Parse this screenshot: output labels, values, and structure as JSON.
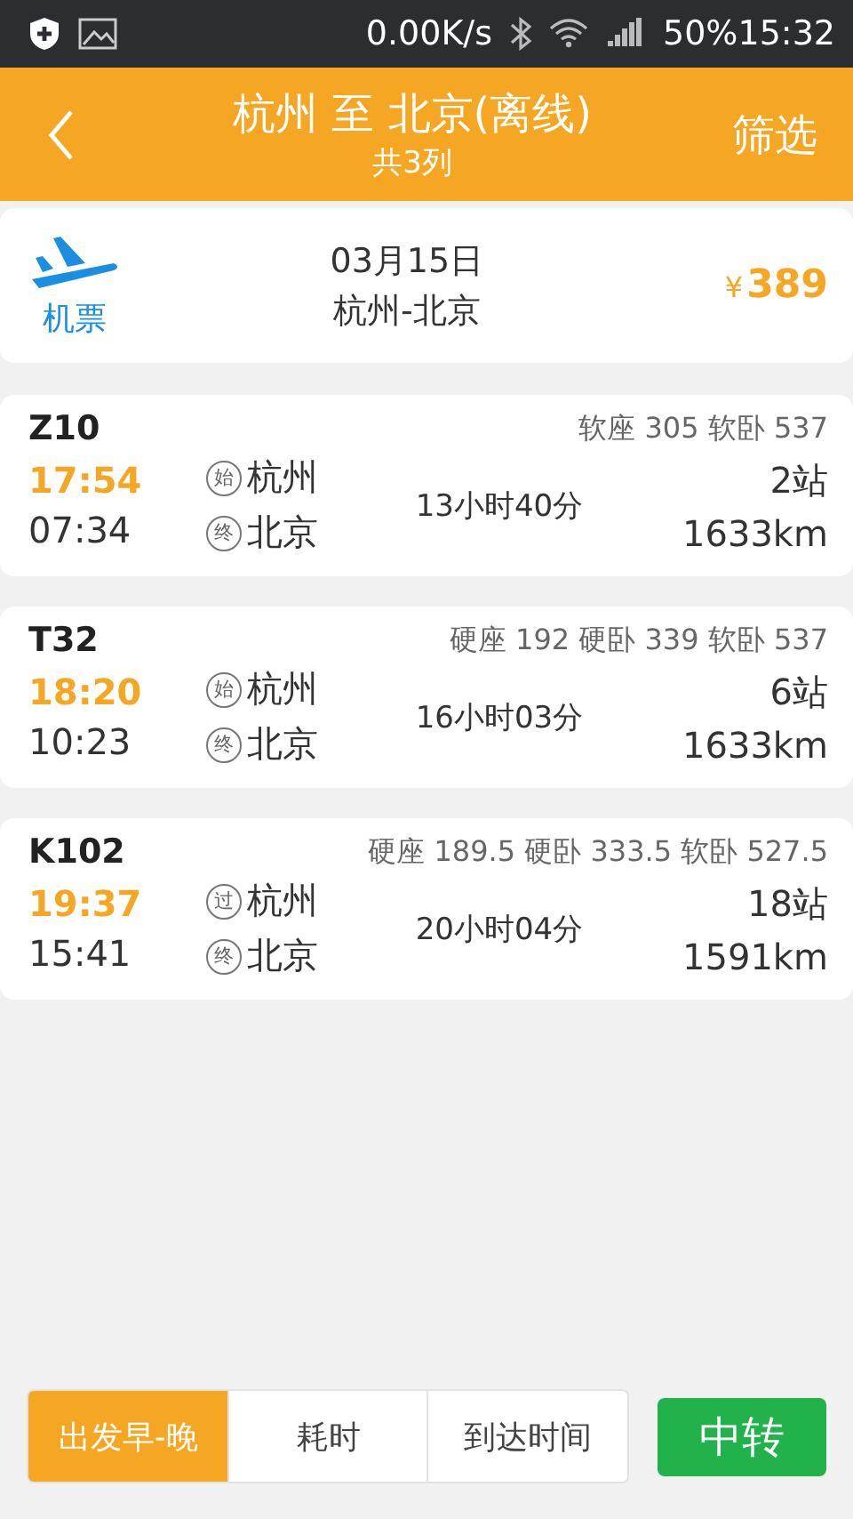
{
  "status_bar": {
    "speed": "0.00K/s",
    "battery": "50%",
    "time": "15:32"
  },
  "header": {
    "title": "杭州 至 北京(离线)",
    "subtitle": "共3列",
    "filter": "筛选"
  },
  "flight": {
    "label": "机票",
    "date": "03月15日",
    "route": "杭州-北京",
    "currency": "¥",
    "price": "389"
  },
  "trains": [
    {
      "number": "Z10",
      "seats": "软座 305 软卧 537",
      "depart_time": "17:54",
      "arrive_time": "07:34",
      "from_mark": "始",
      "from": "杭州",
      "to_mark": "终",
      "to": "北京",
      "duration": "13小时40分",
      "stops": "2站",
      "distance": "1633km"
    },
    {
      "number": "T32",
      "seats": "硬座 192 硬卧 339 软卧 537",
      "depart_time": "18:20",
      "arrive_time": "10:23",
      "from_mark": "始",
      "from": "杭州",
      "to_mark": "终",
      "to": "北京",
      "duration": "16小时03分",
      "stops": "6站",
      "distance": "1633km"
    },
    {
      "number": "K102",
      "seats": "硬座 189.5 硬卧 333.5 软卧 527.5",
      "depart_time": "19:37",
      "arrive_time": "15:41",
      "from_mark": "过",
      "from": "杭州",
      "to_mark": "终",
      "to": "北京",
      "duration": "20小时04分",
      "stops": "18站",
      "distance": "1591km"
    }
  ],
  "sort_tabs": [
    {
      "label": "出发早-晚",
      "selected": true
    },
    {
      "label": "耗时",
      "selected": false
    },
    {
      "label": "到达时间",
      "selected": false
    }
  ],
  "transfer_button": "中转"
}
